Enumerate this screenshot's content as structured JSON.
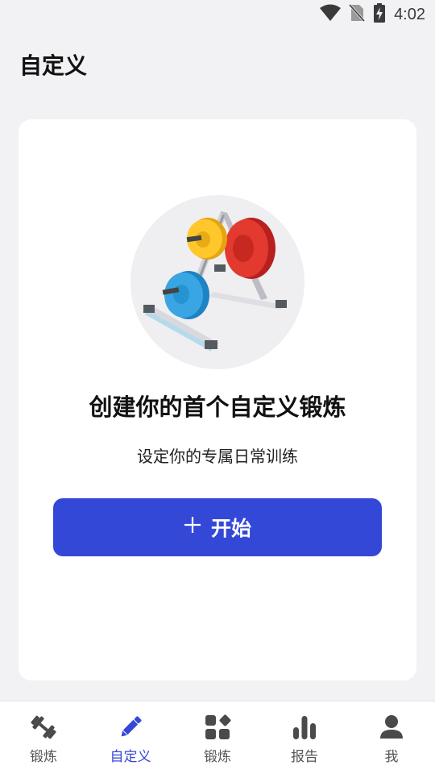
{
  "status_bar": {
    "time": "4:02",
    "icons": [
      "wifi-icon",
      "no-sim-icon",
      "battery-charging-icon"
    ]
  },
  "header": {
    "title": "自定义"
  },
  "empty_state": {
    "illustration": "weight-plates-rack-illustration",
    "title": "创建你的首个自定义锻炼",
    "subtitle": "设定你的专属日常训练",
    "button_label": "开始",
    "button_icon": "plus-icon"
  },
  "bottom_nav": {
    "items": [
      {
        "label": "锻炼",
        "icon": "dumbbell-icon"
      },
      {
        "label": "自定义",
        "icon": "pencil-icon",
        "active": true
      },
      {
        "label": "锻炼",
        "icon": "grid-shapes-icon"
      },
      {
        "label": "报告",
        "icon": "bar-chart-icon"
      },
      {
        "label": "我",
        "icon": "profile-icon"
      }
    ]
  },
  "colors": {
    "accent": "#3448d8",
    "background": "#f2f2f4",
    "card": "#ffffff"
  }
}
